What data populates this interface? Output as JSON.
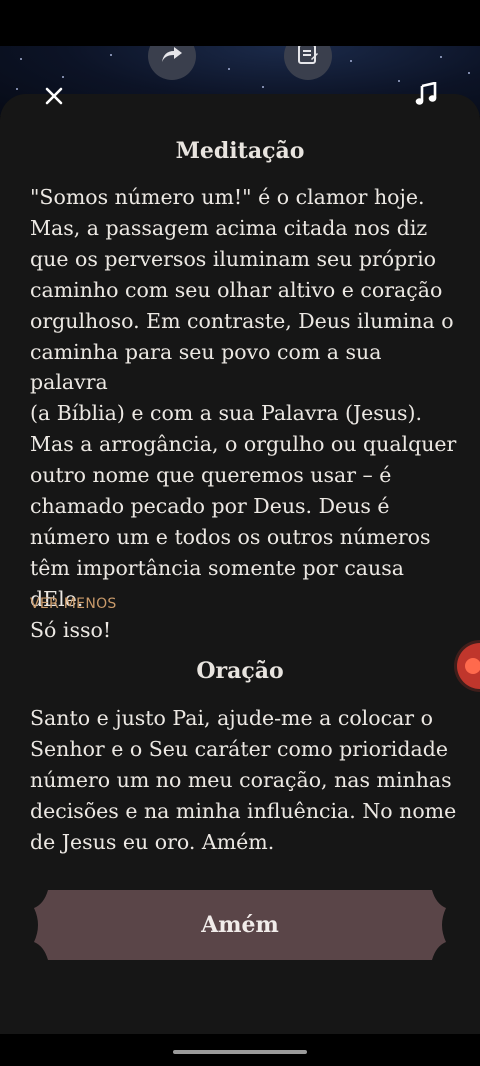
{
  "meditation": {
    "title": "Meditação",
    "lines": [
      "\"Somos número um!\" é o clamor hoje.",
      "Mas, a passagem acima citada nos diz",
      "que os perversos iluminam seu próprio",
      "caminho com seu olhar altivo e coração",
      "orgulhoso. Em contraste, Deus ilumina o",
      "caminha para seu povo com a sua palavra",
      "(a Bíblia) e com a sua Palavra (Jesus).",
      "Mas a arrogância, o orgulho ou qualquer",
      "outro nome que queremos usar – é",
      "chamado pecado por Deus. Deus é",
      "número um e todos os outros números",
      "têm importância somente por causa dEle.",
      "Só isso!"
    ],
    "toggle_label": "VER MENOS"
  },
  "prayer": {
    "title": "Oração",
    "lines": [
      "Santo e justo Pai, ajude-me a colocar o",
      "Senhor e o Seu caráter como prioridade",
      "número um no meu coração, nas minhas",
      "decisões e na minha influência. No nome",
      "de Jesus eu oro. Amém."
    ]
  },
  "amen_button": {
    "label": "Amém"
  },
  "icons": {
    "top_left": "share-icon",
    "top_right": "notes-icon",
    "close": "close-icon",
    "music": "music-note-icon",
    "side": "floating-record-icon"
  },
  "colors": {
    "sheet_background": "#161616",
    "text": "#ece8e3",
    "accent_link": "#c99a6a",
    "button_fill": "#5a4548",
    "floating_handle": "#c0362c"
  }
}
